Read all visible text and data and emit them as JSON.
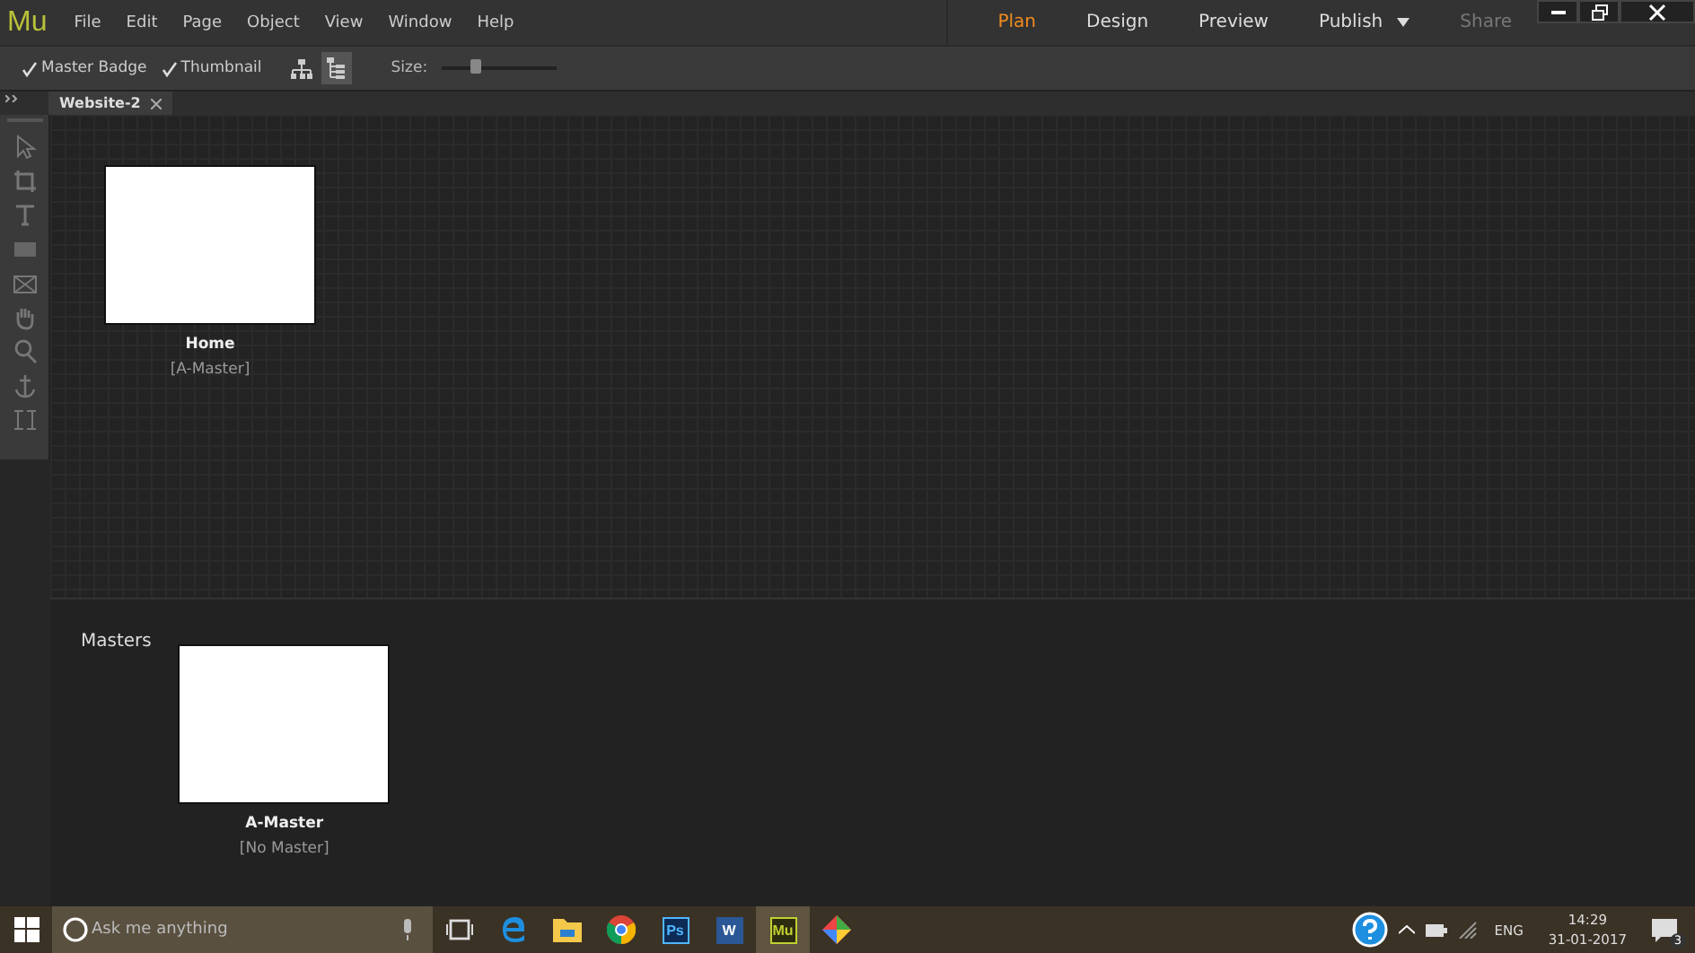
{
  "app": {
    "logo": "Mu"
  },
  "menu": [
    "File",
    "Edit",
    "Page",
    "Object",
    "View",
    "Window",
    "Help"
  ],
  "modes": [
    {
      "label": "Plan",
      "selected": true,
      "disabled": false
    },
    {
      "label": "Design",
      "selected": false,
      "disabled": false
    },
    {
      "label": "Preview",
      "selected": false,
      "disabled": false
    },
    {
      "label": "Publish",
      "selected": false,
      "disabled": false,
      "dropdown": true
    },
    {
      "label": "Share",
      "selected": false,
      "disabled": true
    }
  ],
  "toolbar": {
    "checkboxes": [
      {
        "label": "Master Badge",
        "checked": true
      },
      {
        "label": "Thumbnail",
        "checked": true
      }
    ],
    "views": [
      {
        "kind": "sitemap",
        "selected": false
      },
      {
        "kind": "list",
        "selected": true
      }
    ],
    "size": {
      "label": "Size:",
      "level": 0.3
    }
  },
  "tabs": [
    {
      "label": "Website-2"
    }
  ],
  "tools": [
    {
      "kind": "select"
    },
    {
      "kind": "crop"
    },
    {
      "kind": "text"
    },
    {
      "kind": "rect"
    },
    {
      "kind": "image"
    },
    {
      "kind": "hand"
    },
    {
      "kind": "zoom"
    },
    {
      "kind": "anchor"
    },
    {
      "kind": "align"
    }
  ],
  "pages": [
    {
      "name": "Home",
      "master": "[A-Master]"
    }
  ],
  "masters": {
    "title": "Masters",
    "items": [
      {
        "name": "A-Master",
        "master": "[No Master]"
      }
    ]
  },
  "taskbar": {
    "search_placeholder": "Ask me anything",
    "apps": [
      {
        "kind": "taskview"
      },
      {
        "kind": "edge"
      },
      {
        "kind": "folder"
      },
      {
        "kind": "chrome"
      },
      {
        "kind": "ps",
        "label": "Ps"
      },
      {
        "kind": "word",
        "label": "W"
      },
      {
        "kind": "mu",
        "label": "Mu",
        "selected": true
      },
      {
        "kind": "diamond"
      }
    ],
    "lang": "ENG",
    "time": "14:29",
    "date": "31-01-2017",
    "notifications": "3"
  }
}
